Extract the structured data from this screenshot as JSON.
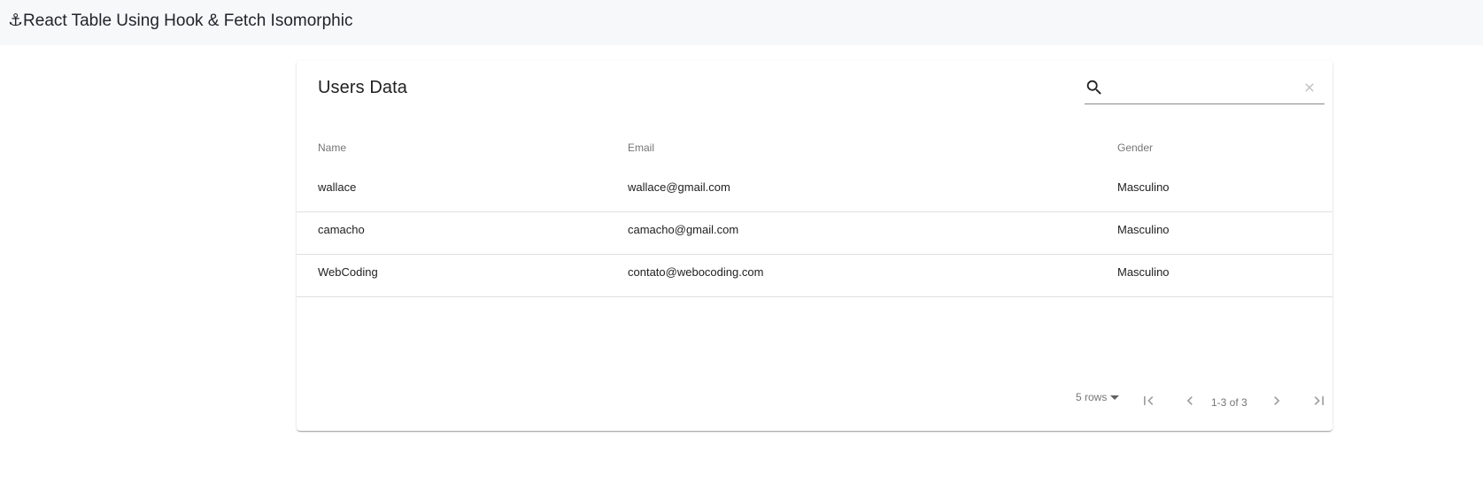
{
  "navbar": {
    "title": "⚓React Table Using Hook & Fetch Isomorphic"
  },
  "card": {
    "title": "Users Data"
  },
  "search": {
    "value": "",
    "placeholder": "",
    "icon": "search-icon",
    "clear_icon": "close-icon"
  },
  "table": {
    "columns": [
      "Name",
      "Email",
      "Gender"
    ],
    "rows": [
      {
        "name": "wallace",
        "email": "wallace@gmail.com",
        "gender": "Masculino"
      },
      {
        "name": "camacho",
        "email": "camacho@gmail.com",
        "gender": "Masculino"
      },
      {
        "name": "WebCoding",
        "email": "contato@webocoding.com",
        "gender": "Masculino"
      }
    ]
  },
  "pagination": {
    "rows_per_page_label": "5 rows",
    "page_info": "1-3 of 3",
    "first_icon": "first-page-icon",
    "prev_icon": "chevron-left-icon",
    "next_icon": "chevron-right-icon",
    "last_icon": "last-page-icon"
  },
  "colors": {
    "navbar_bg": "#f7f8fa",
    "divider": "#e0e0e0",
    "muted_text": "#757575"
  }
}
